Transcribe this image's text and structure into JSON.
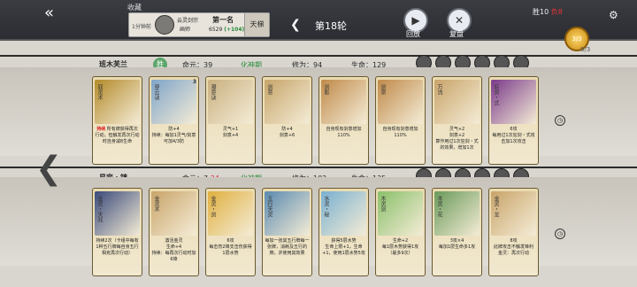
{
  "topbar": {
    "back": "«",
    "fav": "收藏",
    "panel": {
      "days": "1分钟前",
      "name": "云灵剑宗",
      "sub": "画师",
      "rank": "第一名",
      "score": "6529",
      "delta": "(+104)",
      "mode": "天梯"
    },
    "round": "第18轮",
    "round_prev": "❮",
    "play": "回放",
    "play_icon": "▶",
    "reset": "复盘",
    "reset_icon": "✕",
    "win": "胜10",
    "lose": "负8",
    "settings_icon": "⚙",
    "coin": "3/3",
    "coin_label": "0/3"
  },
  "opp": {
    "name": "班木芙兰",
    "icon": "胜",
    "life": "命元：39",
    "realm": "化神期",
    "cult": "修为：94",
    "hp": "生命：129"
  },
  "me": {
    "name": "星弈・镇",
    "life": "命元：7",
    "life_red": "34",
    "realm": "化神期",
    "cult": "修为：102",
    "hp": "生命：135"
  },
  "opp_cards": [
    {
      "name": "驭灵术",
      "level": "",
      "text1": "持续",
      "text2": "所有牌获得再次行动，但触发再次行动时自身减8生命",
      "color": "#b38a2a"
    },
    {
      "name": "穿云诀",
      "level": "3",
      "text1": "",
      "text2": "防+4\n持续：每加1灵气/剑意可加4/3防",
      "color": "#7fa4c9"
    },
    {
      "name": "凝意诀",
      "level": "",
      "text1": "",
      "text2": "灵气+1\n剑意+4",
      "color": "#c9b07f"
    },
    {
      "name": "剑意",
      "level": "",
      "text1": "",
      "text2": "防+4\n剑意+6",
      "color": "#c7a56a"
    },
    {
      "name": "剑影",
      "level": "",
      "text1": "",
      "text2": "自身现有剑意增加110%",
      "color": "#c08a4a"
    },
    {
      "name": "剑意",
      "level": "",
      "text1": "",
      "text2": "自身现有剑意增加110%",
      "color": "#c08a4a"
    },
    {
      "name": "万流",
      "level": "",
      "text1": "",
      "text2": "灵气+2\n剑意+2\n算作用过1次狂剑・式的效果，增加1次",
      "color": "#c9a46a"
    },
    {
      "name": "狂剑・式",
      "level": "",
      "text1": "",
      "text2": "6攻\n每用过1次狂剑・式攻击加1次攻击",
      "color": "#7a3a8a"
    }
  ],
  "my_cards": [
    {
      "name": "金灵・天兆",
      "level": "",
      "text1": "",
      "text2": "持续2次（卡组中每有1种五行牌每自身五行相克再次行动）",
      "color": "#3a4a7a"
    },
    {
      "name": "金灵术",
      "level": "",
      "text1": "",
      "text2": "激活金灵\n生命+4\n持续：每再次行动时加6锋",
      "color": "#c9a46a"
    },
    {
      "name": "金灵・剑",
      "level": "",
      "text1": "",
      "text2": "6攻\n每击伤2锋支击伤获得1层水势",
      "color": "#e0b040"
    },
    {
      "name": "五行天灵",
      "level": "",
      "text1": "",
      "text2": "每加一张其五行牌每一张牌，消耗及五行的牌，并使用其效果",
      "color": "#5a8ab0"
    },
    {
      "name": "水灵・秘",
      "level": "",
      "text1": "",
      "text2": "获得5层水势\n生命上限+1，生命+1，使用1层水势5攻",
      "color": "#7ab0d0"
    },
    {
      "name": "木灵剑",
      "level": "",
      "text1": "",
      "text2": "生命+2\n每1层木势获得1攻（最多9次）",
      "color": "#8ac06a"
    },
    {
      "name": "木灵・花",
      "level": "",
      "text1": "",
      "text2": "3攻×4\n每加1层生命多1攻",
      "color": "#6a9a5a"
    },
    {
      "name": "金灵・龙",
      "level": "",
      "text1": "",
      "text2": "8攻\n此牌攻击不触发锋利\n金灵：再次行动",
      "color": "#c9a46a"
    }
  ]
}
